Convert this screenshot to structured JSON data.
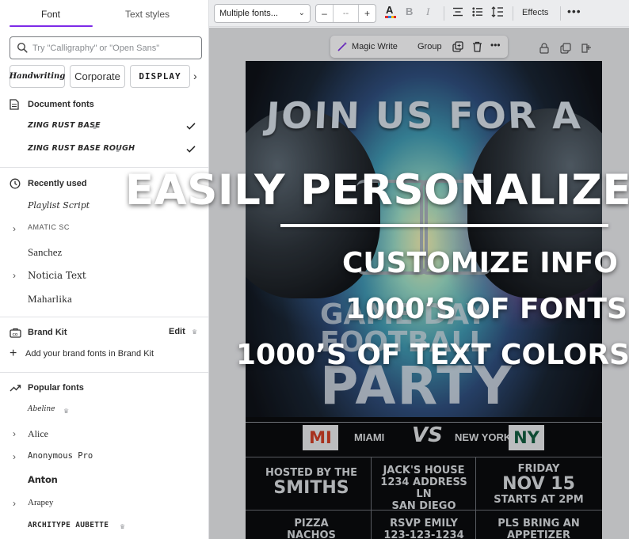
{
  "panel": {
    "tabs": [
      {
        "label": "Font"
      },
      {
        "label": "Text styles"
      }
    ],
    "search_placeholder": "Try \"Calligraphy\" or \"Open Sans\"",
    "chips": [
      "Handwriting",
      "Corporate",
      "DISPLAY"
    ],
    "document_fonts": {
      "title": "Document fonts",
      "items": [
        {
          "label": "ZING RUST BASE",
          "checked": true
        },
        {
          "label": "ZING RUST BASE ROUGH",
          "checked": true
        }
      ]
    },
    "recently_used": {
      "title": "Recently used",
      "items": [
        {
          "label": "Playlist Script"
        },
        {
          "label": "AMATIC SC"
        },
        {
          "label": "Sanchez"
        },
        {
          "label": "Noticia Text"
        },
        {
          "label": "Maharlika"
        }
      ]
    },
    "brand_kit": {
      "title": "Brand Kit",
      "edit_label": "Edit",
      "add_label": "Add your brand fonts in Brand Kit"
    },
    "popular_fonts": {
      "title": "Popular fonts",
      "items": [
        {
          "label": "Abeline"
        },
        {
          "label": "Alice"
        },
        {
          "label": "Anonymous Pro"
        },
        {
          "label": "Anton"
        },
        {
          "label": "Arapey"
        },
        {
          "label": "ARCHITYPE AUBETTE"
        }
      ]
    }
  },
  "toolbar": {
    "font_select": "Multiple fonts...",
    "size_minus": "–",
    "size_value": "--",
    "size_plus": "+",
    "effects_label": "Effects",
    "text_color": "#e02b2b"
  },
  "float_bar": {
    "magic_write": "Magic Write",
    "group": "Group"
  },
  "poster": {
    "headline": "JOIN US FOR A",
    "line_game": "GAME DAY",
    "line_football": "FOOTBALL",
    "line_party": "PARTY",
    "team_left_code": "MI",
    "team_left_name": "MIAMI",
    "vs": "VS",
    "team_right_name": "NEW YORK",
    "team_right_code": "NY",
    "host_top": "HOSTED BY THE",
    "host_big": "SMITHS",
    "venue_1": "JACK'S HOUSE",
    "venue_2": "1234 ADDRESS LN",
    "venue_3": "SAN DIEGO",
    "day": "FRIDAY",
    "date": "NOV 15",
    "time": "STARTS AT 2PM",
    "food_1": "PIZZA",
    "food_2": "NACHOS",
    "rsvp_1": "RSVP EMILY",
    "rsvp_2": "123-123-1234",
    "bring_1": "PLS BRING AN",
    "bring_2": "APPETIZER"
  },
  "overlay": {
    "title": "EASILY PERSONALIZE",
    "line1": "CUSTOMIZE INFO",
    "line2": "1000’S OF FONTS",
    "line3": "1000’S OF TEXT COLORS"
  }
}
